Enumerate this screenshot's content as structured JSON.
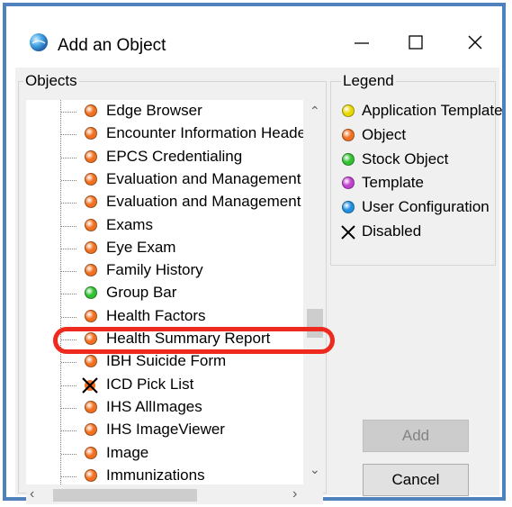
{
  "window": {
    "title": "Add an Object",
    "minimize_glyph": "—",
    "maximize_glyph": "☐",
    "close_glyph": "✕"
  },
  "objects_group": {
    "label": "Objects",
    "items": [
      {
        "label": "Edge Browser",
        "type": "object"
      },
      {
        "label": "Encounter Information Header",
        "type": "object"
      },
      {
        "label": "EPCS Credentialing",
        "type": "object"
      },
      {
        "label": "Evaluation and Management",
        "type": "object"
      },
      {
        "label": "Evaluation and Management (",
        "type": "object"
      },
      {
        "label": "Exams",
        "type": "object"
      },
      {
        "label": "Eye Exam",
        "type": "object"
      },
      {
        "label": "Family History",
        "type": "object"
      },
      {
        "label": "Group Bar",
        "type": "stock"
      },
      {
        "label": "Health Factors",
        "type": "object"
      },
      {
        "label": "Health Summary Report",
        "type": "object"
      },
      {
        "label": "IBH Suicide Form",
        "type": "object"
      },
      {
        "label": "ICD Pick List",
        "type": "disabled"
      },
      {
        "label": "IHS AllImages",
        "type": "object"
      },
      {
        "label": "IHS ImageViewer",
        "type": "object"
      },
      {
        "label": "Image",
        "type": "object"
      },
      {
        "label": "Immunizations",
        "type": "object"
      }
    ],
    "highlighted_item": "IHS AllImages"
  },
  "legend_group": {
    "label": "Legend",
    "items": [
      {
        "label": "Application Template",
        "type": "app-template",
        "color": "#e8d800"
      },
      {
        "label": "Object",
        "type": "object",
        "color": "#f07020"
      },
      {
        "label": "Stock Object",
        "type": "stock",
        "color": "#30c030"
      },
      {
        "label": "Template",
        "type": "template",
        "color": "#c040d0"
      },
      {
        "label": "User Configuration",
        "type": "user-config",
        "color": "#2090e0"
      },
      {
        "label": "Disabled",
        "type": "disabled",
        "color": "#000000"
      }
    ]
  },
  "buttons": {
    "add_label": "Add",
    "cancel_label": "Cancel"
  },
  "colors": {
    "window_border": "#4f81bd",
    "highlight": "#ee2a1e"
  }
}
